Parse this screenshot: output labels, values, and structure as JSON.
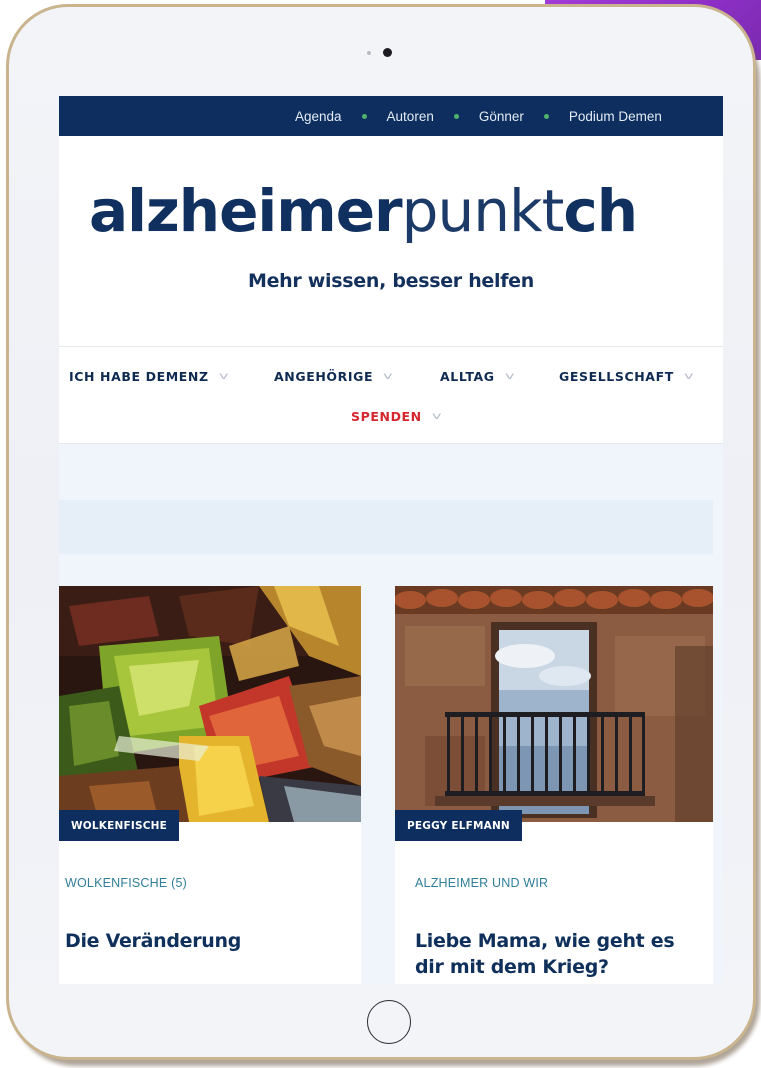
{
  "topbar": {
    "links": [
      {
        "label": "Agenda"
      },
      {
        "label": "Autoren"
      },
      {
        "label": "Gönner"
      },
      {
        "label": "Podium Demen"
      }
    ]
  },
  "brand": {
    "logo_part1": "alzheimer",
    "logo_part2": "punkt",
    "logo_part3": "ch",
    "tagline": "Mehr wissen, besser helfen"
  },
  "nav": {
    "items": [
      {
        "label": "ICH HABE DEMENZ"
      },
      {
        "label": "ANGEHÖRIGE"
      },
      {
        "label": "ALLTAG"
      },
      {
        "label": "GESELLSCHAFT"
      },
      {
        "label": "SPENDEN"
      }
    ]
  },
  "cards": [
    {
      "badge": "WOLKENFISCHE",
      "category": "WOLKENFISCHE (5)",
      "title": "Die Veränderung"
    },
    {
      "badge": "PEGGY ELFMANN",
      "category": "ALZHEIMER UND WIR",
      "title": "Liebe Mama, wie geht es dir mit dem Krieg?"
    }
  ],
  "colors": {
    "navy": "#0d2e5e",
    "accent_green": "#4fb36b",
    "donate_red": "#d6262e",
    "category_teal": "#2f7f98",
    "page_bg": "#f0f5fb"
  }
}
